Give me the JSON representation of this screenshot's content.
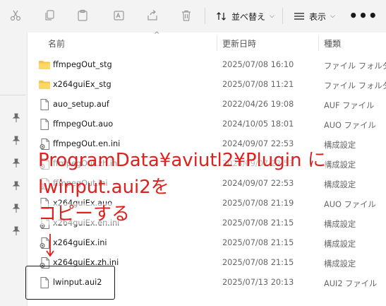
{
  "toolbar": {
    "sort_label": "並べ替え",
    "view_label": "表示",
    "icons": [
      "cut-icon",
      "copy-icon",
      "paste-icon",
      "rename-icon",
      "share-icon",
      "delete-icon"
    ]
  },
  "columns": {
    "name": "名前",
    "date": "更新日時",
    "type": "種類"
  },
  "files": [
    {
      "name": "ffmpegOut_stg",
      "date": "2025/07/08 16:10",
      "type": "ファイル フォルダー",
      "icon": "folder"
    },
    {
      "name": "x264guiEx_stg",
      "date": "2025/07/08 11:21",
      "type": "ファイル フォルダー",
      "icon": "folder"
    },
    {
      "name": "auo_setup.auf",
      "date": "2022/04/26 19:08",
      "type": "AUF ファイル",
      "icon": "file"
    },
    {
      "name": "ffmpegOut.auo",
      "date": "2024/10/05 18:01",
      "type": "AUO ファイル",
      "icon": "file"
    },
    {
      "name": "ffmpegOut.en.ini",
      "date": "2024/09/07 22:53",
      "type": "構成設定",
      "icon": "ini"
    },
    {
      "name": "ffmpegOut.zh.ini",
      "date": "2024/09/07 22:53",
      "type": "構成設定",
      "icon": "ini"
    },
    {
      "name": "ffmpegOut.ini",
      "date": "2024/09/07 22:53",
      "type": "構成設定",
      "icon": "ini"
    },
    {
      "name": "x264guiEx.auo",
      "date": "2025/07/08 21:19",
      "type": "AUO ファイル",
      "icon": "file"
    },
    {
      "name": "x264guiEx.en.ini",
      "date": "2025/07/08 21:15",
      "type": "構成設定",
      "icon": "ini"
    },
    {
      "name": "x264guiEx.ini",
      "date": "2025/07/08 21:15",
      "type": "構成設定",
      "icon": "ini"
    },
    {
      "name": "x264guiEx.zh.ini",
      "date": "2025/07/08 21:15",
      "type": "構成設定",
      "icon": "ini"
    },
    {
      "name": "lwinput.aui2",
      "date": "2025/07/13 20:13",
      "type": "AUI2 ファイル",
      "icon": "file"
    }
  ],
  "annotation": {
    "line1": "ProgramData¥aviutl2¥Plugin に",
    "line2": "lwinput.aui2を",
    "line3": "コピーする",
    "color": "#e0201c"
  }
}
